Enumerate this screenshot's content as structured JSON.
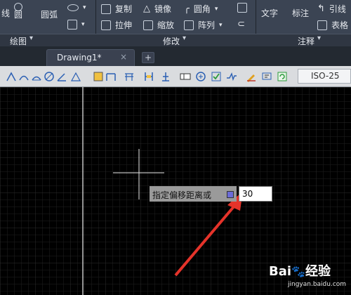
{
  "ribbon": {
    "draw_items": [
      "线",
      "圆",
      "圆弧"
    ],
    "modify_items": [
      "复制",
      "镜像",
      "圆角",
      "拉伸",
      "缩放",
      "阵列"
    ],
    "annotation_items": [
      "文字",
      "标注",
      "引线",
      "表格"
    ],
    "panels": [
      "绘图",
      "修改",
      "注释"
    ]
  },
  "tabs": {
    "active_label": "Drawing1*",
    "close_glyph": "×",
    "add_glyph": "+"
  },
  "toolbar": {
    "dimstyle_value": "ISO-25"
  },
  "command": {
    "prompt_text": "指定偏移距离或",
    "input_value": "30"
  },
  "watermark": {
    "brand": "Bai",
    "brand2": "经验",
    "url": "jingyan.baidu.com"
  },
  "colors": {
    "ribbon_bg": "#3b4453",
    "canvas_bg": "#000000",
    "grid": "#222222",
    "arrow": "#e5332a"
  }
}
